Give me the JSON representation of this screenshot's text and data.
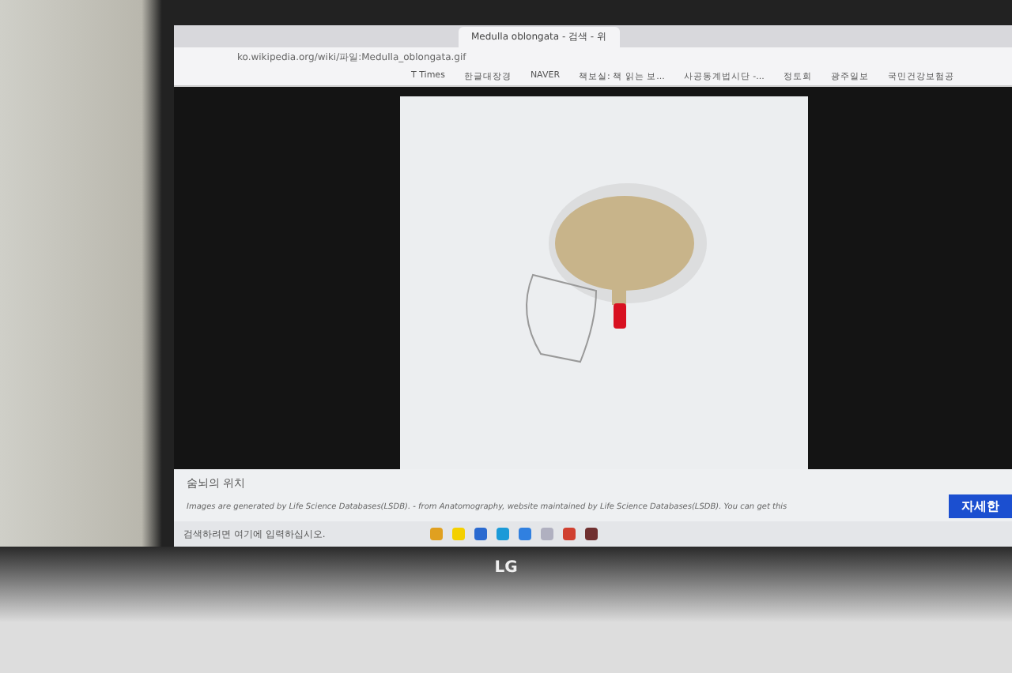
{
  "browser": {
    "tabs": [
      {
        "label": "Medulla oblongata - 검색 - 위",
        "selected": true
      }
    ],
    "address": "ko.wikipedia.org/wiki/파일:Medulla_oblongata.gif",
    "bookmarks": [
      {
        "label": "T Times"
      },
      {
        "label": "한글대장경"
      },
      {
        "label": "NAVER"
      },
      {
        "label": "책보실: 책 읽는 보..."
      },
      {
        "label": "사공동계법시단 -..."
      },
      {
        "label": "정토회"
      },
      {
        "label": "광주일보"
      },
      {
        "label": "국민건강보험공"
      }
    ]
  },
  "caption": {
    "title": "숨뇌의 위치",
    "credit": "Images are generated by Life Science Databases(LSDB). - from Anatomography, website maintained by Life Science Databases(LSDB). You can get this",
    "button": "자세한"
  },
  "taskbar": {
    "search_placeholder": "검색하려면 여기에 입력하십시오."
  },
  "laptop": {
    "brand": "LG"
  }
}
